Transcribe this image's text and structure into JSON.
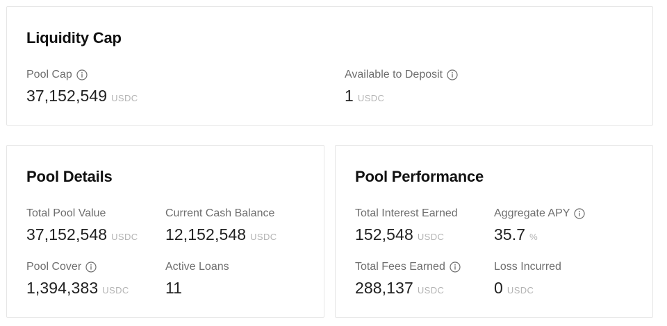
{
  "liquidity_cap": {
    "title": "Liquidity Cap",
    "pool_cap": {
      "label": "Pool Cap",
      "value": "37,152,549",
      "unit": "USDC"
    },
    "available_to_deposit": {
      "label": "Available to Deposit",
      "value": "1",
      "unit": "USDC"
    }
  },
  "pool_details": {
    "title": "Pool Details",
    "total_pool_value": {
      "label": "Total Pool Value",
      "value": "37,152,548",
      "unit": "USDC"
    },
    "current_cash_balance": {
      "label": "Current Cash Balance",
      "value": "12,152,548",
      "unit": "USDC"
    },
    "pool_cover": {
      "label": "Pool Cover",
      "value": "1,394,383",
      "unit": "USDC"
    },
    "active_loans": {
      "label": "Active Loans",
      "value": "11"
    }
  },
  "pool_performance": {
    "title": "Pool Performance",
    "total_interest_earned": {
      "label": "Total Interest Earned",
      "value": "152,548",
      "unit": "USDC"
    },
    "aggregate_apy": {
      "label": "Aggregate APY",
      "value": "35.7",
      "unit": "%"
    },
    "total_fees_earned": {
      "label": "Total Fees Earned",
      "value": "288,137",
      "unit": "USDC"
    },
    "loss_incurred": {
      "label": "Loss Incurred",
      "value": "0",
      "unit": "USDC"
    }
  },
  "icons": {
    "info": "info-circle-icon"
  },
  "colors": {
    "card_border": "#e6e6e6",
    "title": "#111111",
    "label": "#6e6e6e",
    "value": "#222222",
    "unit": "#b3b3b3"
  }
}
